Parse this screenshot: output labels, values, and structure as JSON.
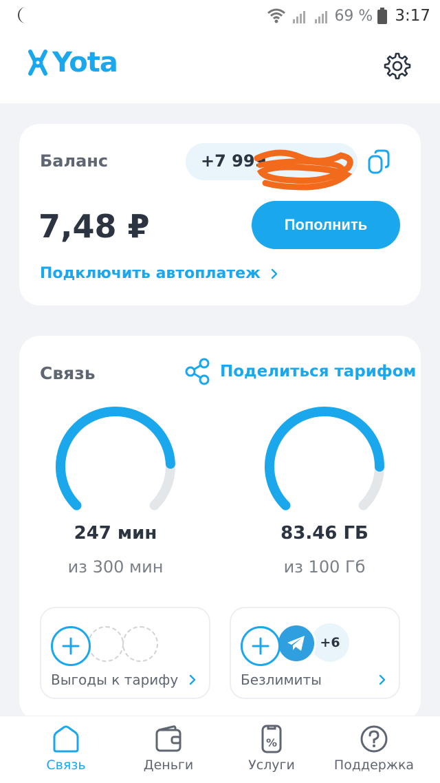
{
  "status_bar": {
    "battery_text": "69 %",
    "time": "3:17"
  },
  "header": {
    "brand": "Yota"
  },
  "balance": {
    "title": "Баланс",
    "phone": "+7 999",
    "amount": "7,48 ₽",
    "topup_label": "Пополнить",
    "autopay_label": "Подключить автоплатеж"
  },
  "svyaz": {
    "title": "Связь",
    "share_label": "Поделиться тарифом",
    "minutes": {
      "value_text": "247 мин",
      "total_text": "из 300 мин",
      "used": 247,
      "total": 300
    },
    "data": {
      "value_text": "83.46 ГБ",
      "total_text": "из 100 Гб",
      "used": 83.46,
      "total": 100
    },
    "benefits_label": "Выгоды к тарифу",
    "unlimited_label": "Безлимиты",
    "unlimited_more": "+6"
  },
  "nav": {
    "items": [
      {
        "label": "Связь",
        "icon": "home-icon"
      },
      {
        "label": "Деньги",
        "icon": "wallet-icon"
      },
      {
        "label": "Услуги",
        "icon": "services-icon"
      },
      {
        "label": "Поддержка",
        "icon": "support-icon"
      }
    ],
    "active_index": 0
  },
  "colors": {
    "accent": "#1aa7ec",
    "gauge_track": "#e4e7ea"
  }
}
